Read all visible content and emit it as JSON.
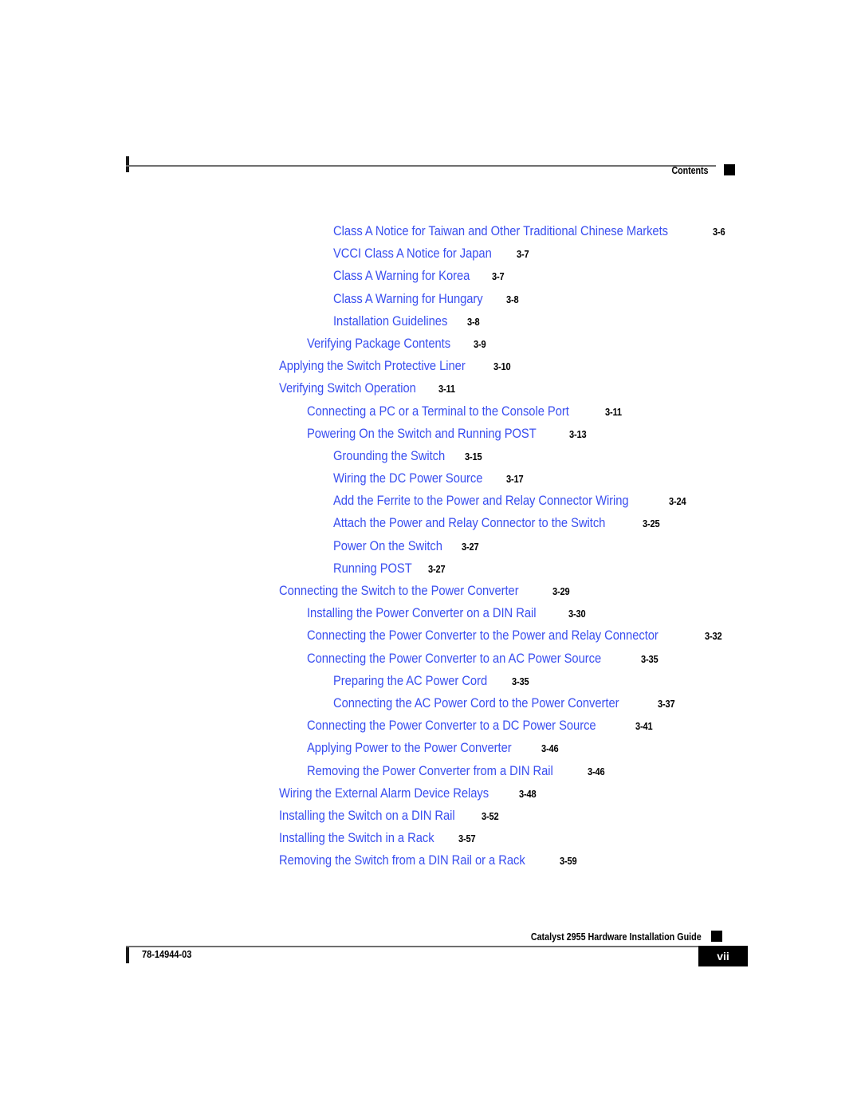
{
  "header": {
    "title": "Contents"
  },
  "toc": {
    "entries": [
      {
        "title": "Class A Notice for Taiwan and Other Traditional Chinese Markets",
        "page": "3-6",
        "level": 3
      },
      {
        "title": "VCCI Class A Notice for Japan",
        "page": "3-7",
        "level": 3
      },
      {
        "title": "Class A Warning for Korea",
        "page": "3-7",
        "level": 3
      },
      {
        "title": "Class A Warning for Hungary",
        "page": "3-8",
        "level": 3
      },
      {
        "title": "Installation Guidelines",
        "page": "3-8",
        "level": 3
      },
      {
        "title": "Verifying Package Contents",
        "page": "3-9",
        "level": 2
      },
      {
        "title": "Applying the Switch Protective Liner",
        "page": "3-10",
        "level": 1
      },
      {
        "title": "Verifying Switch Operation",
        "page": "3-11",
        "level": 1
      },
      {
        "title": "Connecting a PC or a Terminal to the Console Port",
        "page": "3-11",
        "level": 2
      },
      {
        "title": "Powering On the Switch and Running POST",
        "page": "3-13",
        "level": 2
      },
      {
        "title": "Grounding the Switch",
        "page": "3-15",
        "level": 3
      },
      {
        "title": "Wiring the DC Power Source",
        "page": "3-17",
        "level": 3
      },
      {
        "title": "Add the Ferrite to the Power and Relay Connector Wiring",
        "page": "3-24",
        "level": 3
      },
      {
        "title": "Attach the Power and Relay Connector to the Switch",
        "page": "3-25",
        "level": 3
      },
      {
        "title": "Power On the Switch",
        "page": "3-27",
        "level": 3
      },
      {
        "title": "Running POST",
        "page": "3-27",
        "level": 3
      },
      {
        "title": "Connecting the Switch to the Power Converter",
        "page": "3-29",
        "level": 1
      },
      {
        "title": "Installing the Power Converter on a DIN Rail",
        "page": "3-30",
        "level": 2
      },
      {
        "title": "Connecting the Power Converter to the Power and Relay Connector",
        "page": "3-32",
        "level": 2
      },
      {
        "title": "Connecting the Power Converter to an AC Power Source",
        "page": "3-35",
        "level": 2
      },
      {
        "title": "Preparing the AC Power Cord",
        "page": "3-35",
        "level": 3
      },
      {
        "title": "Connecting the AC Power Cord to the Power Converter",
        "page": "3-37",
        "level": 3
      },
      {
        "title": "Connecting the Power Converter to a DC Power Source",
        "page": "3-41",
        "level": 2
      },
      {
        "title": "Applying Power to the Power Converter",
        "page": "3-46",
        "level": 2
      },
      {
        "title": "Removing the Power Converter from a DIN Rail",
        "page": "3-46",
        "level": 2
      },
      {
        "title": "Wiring the External Alarm Device Relays",
        "page": "3-48",
        "level": 1
      },
      {
        "title": "Installing the Switch on a DIN Rail",
        "page": "3-52",
        "level": 1
      },
      {
        "title": "Installing the Switch in a Rack",
        "page": "3-57",
        "level": 1
      },
      {
        "title": "Removing the Switch from a DIN Rail or a Rack",
        "page": "3-59",
        "level": 1
      }
    ]
  },
  "footer": {
    "guide_title": "Catalyst 2955 Hardware Installation Guide",
    "doc_id": "78-14944-03",
    "page_number": "vii"
  },
  "colors": {
    "link_blue": "#3a4ff0",
    "rule_gray": "#6f6f6f",
    "ink_black": "#000000"
  }
}
